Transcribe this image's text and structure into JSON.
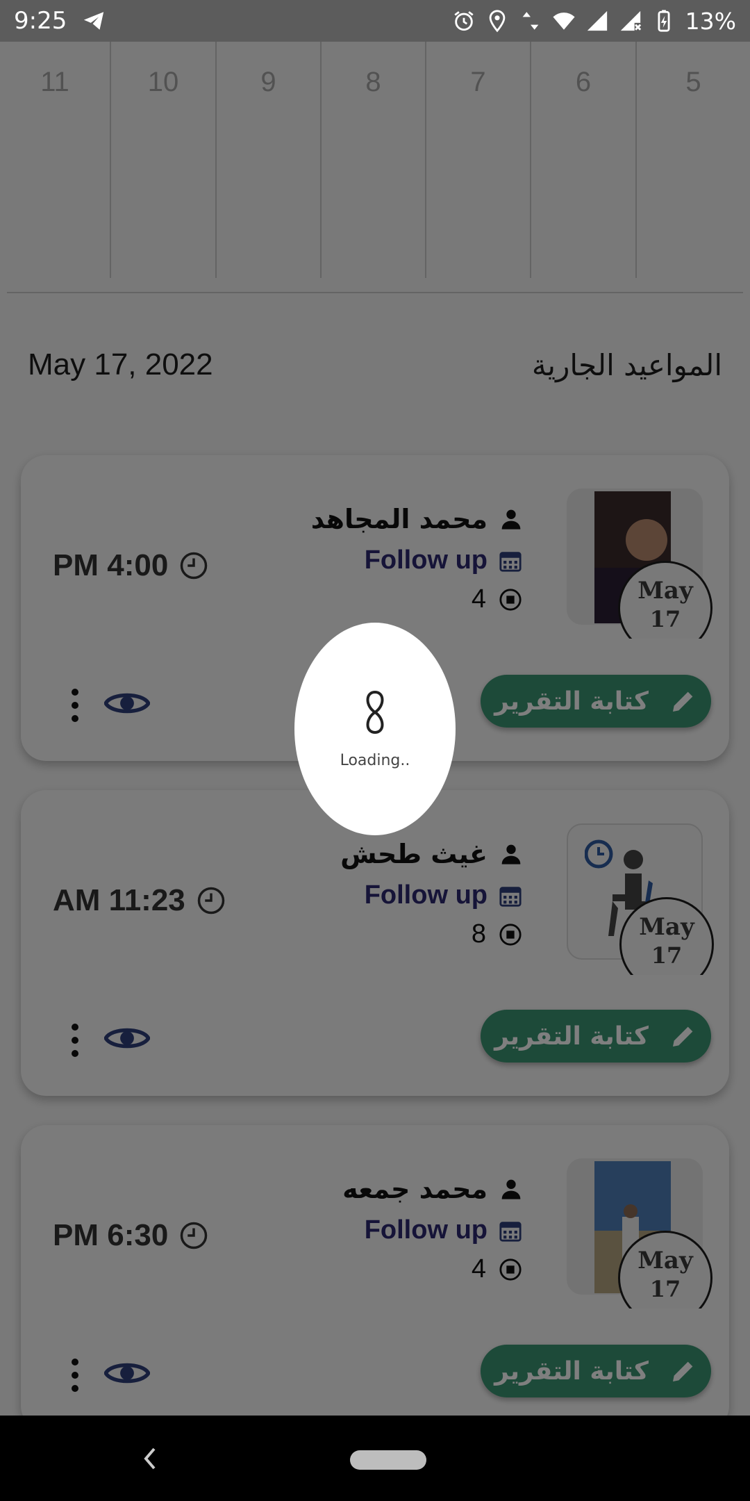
{
  "status_bar": {
    "time": "9:25",
    "battery": "13%",
    "icons": [
      "telegram-icon",
      "alarm-icon",
      "location-icon",
      "data-arrows-icon",
      "wifi-icon",
      "signal-icon",
      "signal-x-icon",
      "battery-charging-icon"
    ]
  },
  "calendar": {
    "days": [
      "5",
      "6",
      "7",
      "8",
      "9",
      "10",
      "11"
    ]
  },
  "header": {
    "date": "May 17, 2022",
    "title": "المواعيد الجارية"
  },
  "appointments": [
    {
      "patient": "محمد المجاهد",
      "type": "Follow up",
      "count": "4",
      "time": "PM 4:00",
      "badge_month": "May",
      "badge_day": "17",
      "thumb": "photo",
      "report_label": "كتابة التقرير"
    },
    {
      "patient": "غيث طحش",
      "type": "Follow up",
      "count": "8",
      "time": "AM 11:23",
      "badge_month": "May",
      "badge_day": "17",
      "thumb": "waiting-room-icon",
      "report_label": "كتابة التقرير"
    },
    {
      "patient": "محمد جمعه",
      "type": "Follow up",
      "count": "4",
      "time": "PM 6:30",
      "badge_month": "May",
      "badge_day": "17",
      "thumb": "photo",
      "report_label": "كتابة التقرير"
    }
  ],
  "loader": {
    "text": "Loading.."
  },
  "colors": {
    "accent_green": "#3a9572",
    "type_purple": "#2d2870",
    "eye_blue": "#2e3f7a"
  }
}
